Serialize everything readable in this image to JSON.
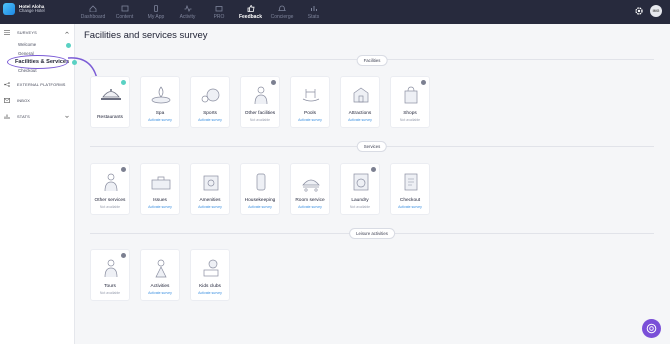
{
  "brand": {
    "hotel": "Hotel Aloha",
    "switch": "Change Hotel"
  },
  "nav": [
    "Dashboard",
    "Content",
    "My App",
    "Activity",
    "PRO",
    "Feedback",
    "Concierge",
    "Stats"
  ],
  "user": {
    "initials": "IMG"
  },
  "sidebar": {
    "surveys": "SURVEYS",
    "welcome": "Welcome",
    "general": "General",
    "active": "Facilities & Services",
    "checkout": "Checkout",
    "external": "EXTERNAL PLATFORMS",
    "inbox": "INBOX",
    "stats": "STATS"
  },
  "main": {
    "title": "Facilities and services survey",
    "sections": [
      "Facilities",
      "Services",
      "Leisure activities"
    ]
  },
  "cards": {
    "facilities": [
      {
        "name": "Restaurants",
        "status": ""
      },
      {
        "name": "Spa",
        "status": "Activate survey"
      },
      {
        "name": "Sports",
        "status": "Activate survey"
      },
      {
        "name": "Other facilities",
        "status": "Not available"
      },
      {
        "name": "Pools",
        "status": "Activate survey"
      },
      {
        "name": "Attractions",
        "status": "Activate survey"
      },
      {
        "name": "Shops",
        "status": "Not available"
      }
    ],
    "services": [
      {
        "name": "Other services",
        "status": "Not available"
      },
      {
        "name": "Issues",
        "status": "Activate survey"
      },
      {
        "name": "Amenities",
        "status": "Activate survey"
      },
      {
        "name": "Housekeeping",
        "status": "Activate survey"
      },
      {
        "name": "Room service",
        "status": "Activate survey"
      },
      {
        "name": "Laundry",
        "status": "Not available"
      },
      {
        "name": "Checkout",
        "status": "Activate survey"
      }
    ],
    "leisure": [
      {
        "name": "Tours",
        "status": "Not available"
      },
      {
        "name": "Activities",
        "status": "Activate survey"
      },
      {
        "name": "Kids clubs",
        "status": "Activate survey"
      }
    ]
  },
  "colors": {
    "accent": "#3a8fe0",
    "topbar": "#272a3d",
    "check": "#5ad1c3",
    "annotation": "#7b5cd6",
    "chat": "#7a4fd8"
  },
  "icons": [
    "gear-icon",
    "chat-support-icon",
    "check-badge-icon",
    "info-badge-icon",
    "chevron-down-icon"
  ]
}
